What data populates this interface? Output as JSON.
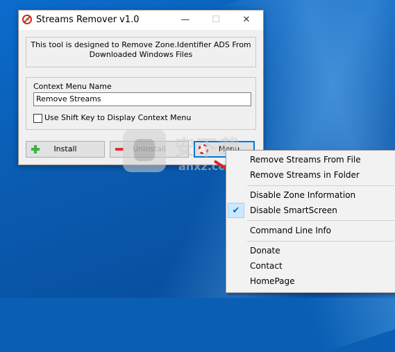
{
  "window": {
    "title": "Streams Remover v1.0",
    "minimize_glyph": "—",
    "maximize_glyph": "☐",
    "close_glyph": "✕"
  },
  "info": {
    "line1": "This tool is designed to Remove Zone.Identifier ADS From",
    "line2": "Downloaded Windows Files"
  },
  "context_group": {
    "label": "Context Menu Name",
    "input_value": "Remove Streams",
    "checkbox_label": "Use Shift Key to Display Context Menu",
    "checkbox_checked": false
  },
  "buttons": {
    "install": "Install",
    "uninstall": "Uninstall",
    "menu": "Menu"
  },
  "watermark": {
    "main": "安下载",
    "sub": "anxz.com"
  },
  "context_menu": {
    "items": [
      {
        "label": "Remove Streams From File"
      },
      {
        "label": "Remove Streams in Folder"
      },
      {
        "label": "Disable Zone Information"
      },
      {
        "label": "Disable SmartScreen",
        "checked": true
      },
      {
        "label": "Command Line Info"
      },
      {
        "label": "Donate"
      },
      {
        "label": "Contact"
      },
      {
        "label": "HomePage"
      }
    ]
  },
  "colors": {
    "desktop": "#0a5fb4",
    "accent": "#0078d7",
    "install_icon": "#3cb043",
    "uninstall_icon": "#e0303a"
  }
}
